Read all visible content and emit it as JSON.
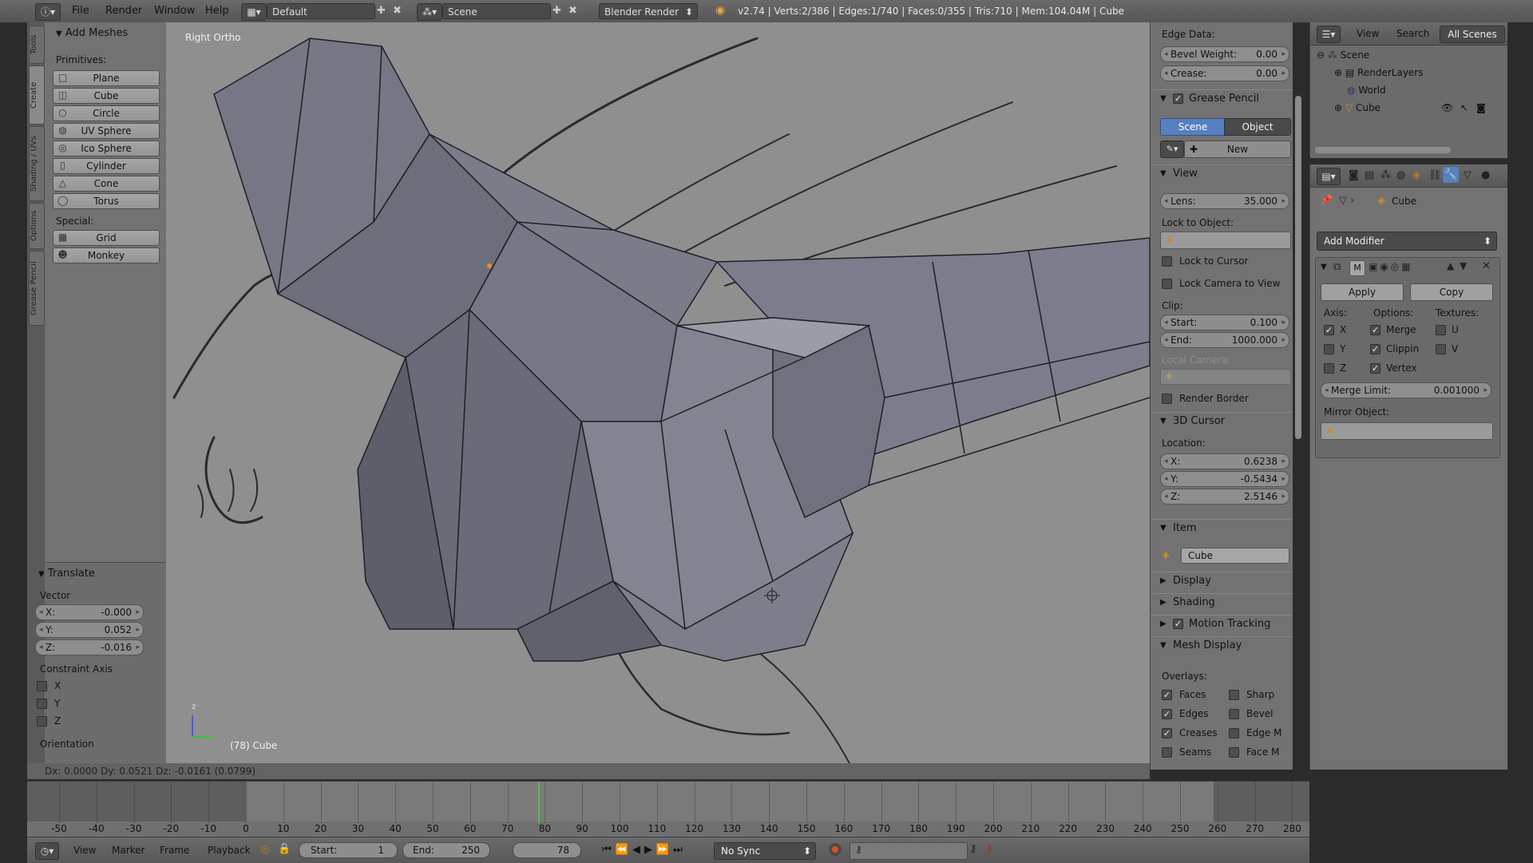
{
  "header": {
    "menus": [
      "File",
      "Render",
      "Window",
      "Help"
    ],
    "screen_layout": "Default",
    "scene": "Scene",
    "render_engine": "Blender Render",
    "stats": "v2.74 | Verts:2/386 | Edges:1/740 | Faces:0/355 | Tris:710 | Mem:104.04M | Cube"
  },
  "tabs": [
    "Tools",
    "Create",
    "Shading / UVs",
    "Options",
    "Grease Pencil"
  ],
  "add_meshes": {
    "title": "Add Meshes",
    "primitives_label": "Primitives:",
    "primitives": [
      "Plane",
      "Cube",
      "Circle",
      "UV Sphere",
      "Ico Sphere",
      "Cylinder",
      "Cone",
      "Torus"
    ],
    "special_label": "Special:",
    "special": [
      "Grid",
      "Monkey"
    ]
  },
  "translate": {
    "title": "Translate",
    "vector_label": "Vector",
    "x": {
      "label": "X:",
      "value": "-0.000"
    },
    "y": {
      "label": "Y:",
      "value": "0.052"
    },
    "z": {
      "label": "Z:",
      "value": "-0.016"
    },
    "constraint_label": "Constraint Axis",
    "axes": [
      "X",
      "Y",
      "Z"
    ],
    "orientation_label": "Orientation"
  },
  "viewport": {
    "view_name": "Right Ortho",
    "object_info": "(78) Cube",
    "axis_label": "z"
  },
  "hud_status": "Dx: 0.0000  Dy: 0.0521  Dz: -0.0161 (0.0799)",
  "npanel": {
    "edge_data_label": "Edge Data:",
    "bevel_weight": {
      "label": "Bevel Weight:",
      "value": "0.00"
    },
    "crease": {
      "label": "Crease:",
      "value": "0.00"
    },
    "grease_pencil": {
      "title": "Grease Pencil",
      "scene_btn": "Scene",
      "object_btn": "Object",
      "new_btn": "New"
    },
    "view": {
      "title": "View",
      "lens": {
        "label": "Lens:",
        "value": "35.000"
      },
      "lock_to_object": "Lock to Object:",
      "lock_to_cursor": "Lock to Cursor",
      "lock_camera": "Lock Camera to View",
      "clip_label": "Clip:",
      "clip_start": {
        "label": "Start:",
        "value": "0.100"
      },
      "clip_end": {
        "label": "End:",
        "value": "1000.000"
      },
      "local_camera": "Local Camera:",
      "render_border": "Render Border"
    },
    "cursor": {
      "title": "3D Cursor",
      "location_label": "Location:",
      "x": {
        "label": "X:",
        "value": "0.6238"
      },
      "y": {
        "label": "Y:",
        "value": "-0.5434"
      },
      "z": {
        "label": "Z:",
        "value": "2.5146"
      }
    },
    "item": {
      "title": "Item",
      "name": "Cube"
    },
    "collapsed": [
      "Display",
      "Shading",
      "Motion Tracking"
    ],
    "mesh_display": {
      "title": "Mesh Display",
      "overlays_label": "Overlays:",
      "left": [
        "Faces",
        "Edges",
        "Creases",
        "Seams"
      ],
      "right": [
        "Sharp",
        "Bevel",
        "Edge M",
        "Face M"
      ]
    }
  },
  "outliner": {
    "menus": [
      "View",
      "Search",
      "All Scenes"
    ],
    "tree": [
      "Scene",
      "RenderLayers",
      "World",
      "Cube"
    ]
  },
  "properties": {
    "context_object": "Cube",
    "add_modifier": "Add Modifier",
    "modifier_short": "M",
    "apply": "Apply",
    "copy": "Copy",
    "axis_label": "Axis:",
    "options_label": "Options:",
    "textures_label": "Textures:",
    "axis": [
      "X",
      "Y",
      "Z"
    ],
    "options": [
      "Merge",
      "Clippin",
      "Vertex"
    ],
    "textures": [
      "U",
      "V"
    ],
    "merge_limit": {
      "label": "Merge Limit:",
      "value": "0.001000"
    },
    "mirror_object": "Mirror Object:"
  },
  "timeline": {
    "ticks": [
      "-50",
      "-40",
      "-30",
      "-20",
      "-10",
      "0",
      "10",
      "20",
      "30",
      "40",
      "50",
      "60",
      "70",
      "80",
      "90",
      "100",
      "110",
      "120",
      "130",
      "140",
      "150",
      "160",
      "170",
      "180",
      "190",
      "200",
      "210",
      "220",
      "230",
      "240",
      "250",
      "260",
      "270",
      "280"
    ],
    "current_frame": "78",
    "menus": [
      "View",
      "Marker",
      "Frame",
      "Playback"
    ],
    "start": {
      "label": "Start:",
      "value": "1"
    },
    "end": {
      "label": "End:",
      "value": "250"
    },
    "sync": "No Sync"
  },
  "colors": {
    "accent": "#5680c2",
    "frame_line": "#4ec24e",
    "viewport_bg": "#8f8f8f",
    "mesh_face": "#757784"
  }
}
